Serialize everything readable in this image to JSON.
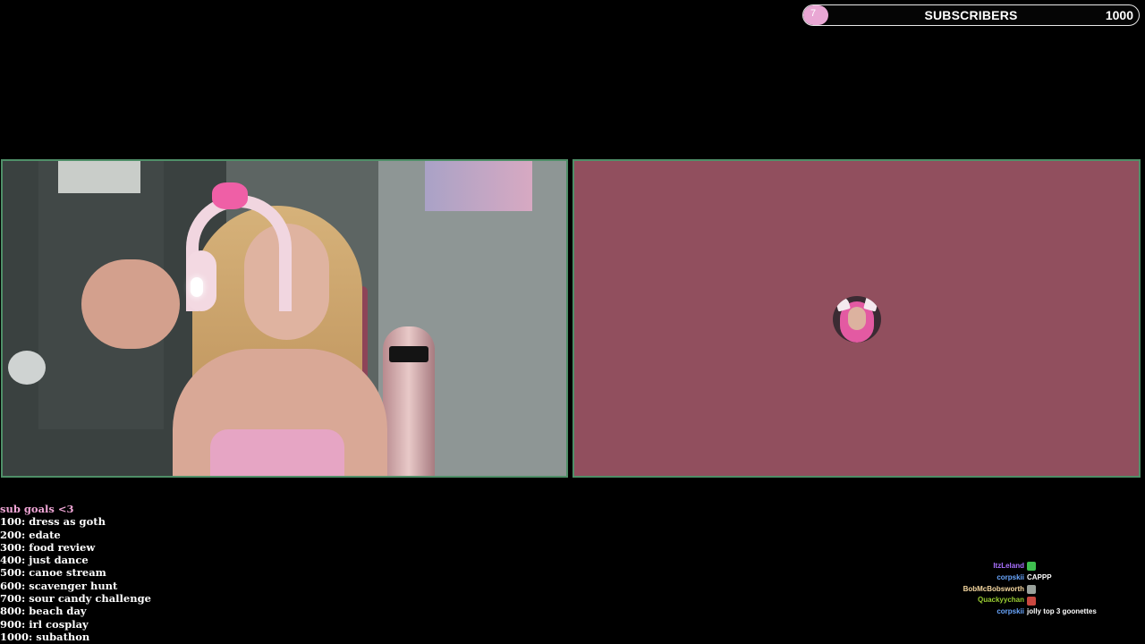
{
  "subscribers": {
    "current": "7",
    "label": "SUBSCRIBERS",
    "goal": "1000",
    "progress_fraction": 0.007,
    "fill_color": "#e9a7d4"
  },
  "webcam": {
    "description_icon": "webcam-feed"
  },
  "screen": {
    "background_color": "#914f5e",
    "avatar_icon": "streamer-avatar"
  },
  "goals": {
    "title": "sub goals <3",
    "items": [
      "100: dress as goth",
      "200: edate",
      "300: food review",
      "400: just dance",
      "500: canoe stream",
      "600: scavenger hunt",
      "700: sour candy challenge",
      "800: beach day",
      "900: irl cosplay",
      "1000: subathon"
    ]
  },
  "chat": [
    {
      "user": "ItzLeland",
      "color": "#a970ff",
      "text": "",
      "emote": "whatsapp-emote",
      "emote_color": "#3fbf4f"
    },
    {
      "user": "corpskii",
      "color": "#6aa7ff",
      "text": "CAPPP",
      "emote": "",
      "emote_color": ""
    },
    {
      "user": "BobMcBobsworth",
      "color": "#f5d7a0",
      "text": "",
      "emote": "meme-emote",
      "emote_color": "#9aa29c"
    },
    {
      "user": "Quackyychan",
      "color": "#9acd32",
      "text": "",
      "emote": "pepe-emote",
      "emote_color": "#c9473f"
    },
    {
      "user": "corpskii",
      "color": "#6aa7ff",
      "text": "jolly top 3 goonettes",
      "emote": "",
      "emote_color": ""
    }
  ]
}
